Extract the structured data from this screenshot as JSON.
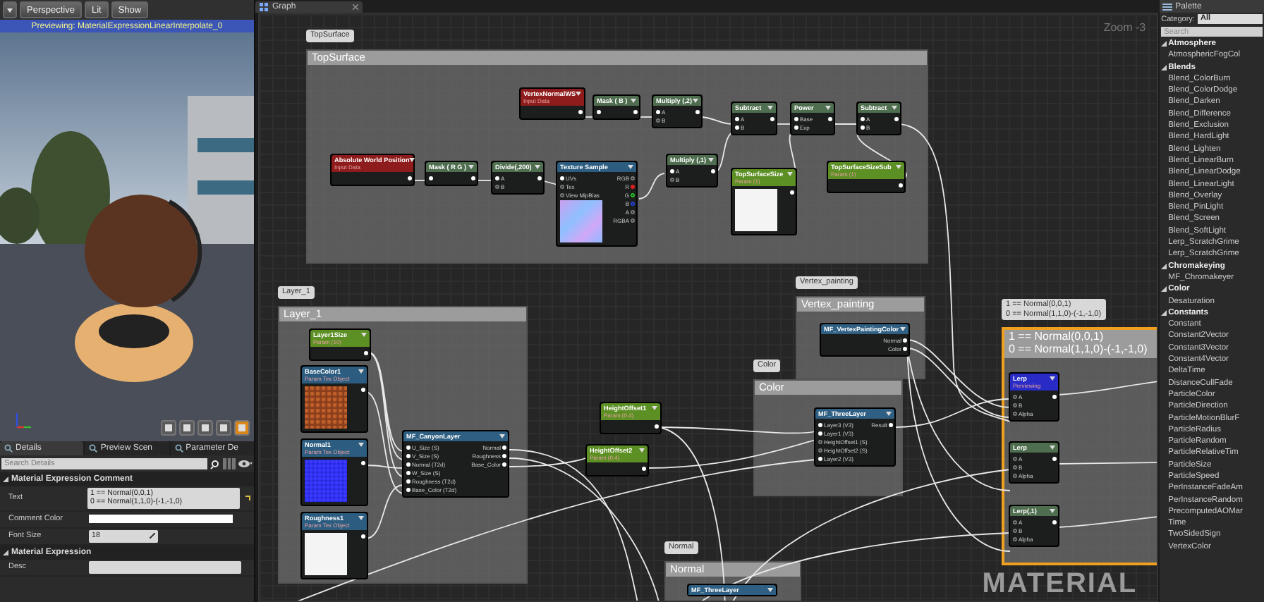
{
  "viewport": {
    "toolbar": [
      {
        "label": "Perspective"
      },
      {
        "label": "Lit"
      },
      {
        "label": "Show"
      }
    ],
    "status": "Previewing: MaterialExpressionLinearInterpolate_0",
    "view_buttons": [
      {
        "selected": false
      },
      {
        "selected": false
      },
      {
        "selected": false
      },
      {
        "selected": false
      },
      {
        "selected": true
      }
    ]
  },
  "details": {
    "tabs": [
      {
        "label": "Details",
        "selected": true
      },
      {
        "label": "Preview Scen",
        "selected": false
      },
      {
        "label": "Parameter De",
        "selected": false
      }
    ],
    "search": {
      "placeholder": "Search Details"
    },
    "sections": [
      {
        "title": "Material Expression Comment",
        "expanded": true,
        "rows": [
          {
            "kind": "multiline",
            "label": "Text",
            "value": "1 == Normal(0,0,1)\n0 == Normal(1,1,0)-(-1,-1,0)"
          },
          {
            "kind": "swatch",
            "label": "Comment Color"
          },
          {
            "kind": "number",
            "label": "Font Size",
            "value": "18"
          }
        ]
      },
      {
        "title": "Material Expression",
        "expanded": true,
        "rows": [
          {
            "kind": "field",
            "label": "Desc"
          }
        ]
      }
    ]
  },
  "graph": {
    "tab": "Graph",
    "zoom": "Zoom -3",
    "watermark": "MATERIAL",
    "comments": [
      {
        "bubble": "TopSurface",
        "title": "TopSurface",
        "selected": false
      },
      {
        "bubble": "Layer_1",
        "title": "Layer_1",
        "selected": false
      },
      {
        "bubble": "Vertex_painting",
        "title": "Vertex_painting",
        "selected": false
      },
      {
        "bubble": "Color",
        "title": "Color",
        "selected": false
      },
      {
        "bubble": "Normal",
        "title": "Normal",
        "selected": false
      },
      {
        "bubble": "1 == Normal(0,0,1)\n0 == Normal(1,1,0)-(-1,-1,0)",
        "title": "1 == Normal(0,0,1)\n0 == Normal(1,1,0)-(-1,-1,0)",
        "selected": true
      }
    ],
    "nodes": [
      {
        "kind": "input",
        "title": "VertexNormalWS",
        "subtitle": "Input Data",
        "selected": false,
        "outputs": [
          {
            "connected": true
          }
        ]
      },
      {
        "kind": "math",
        "title": "Mask ( B )",
        "selected": false,
        "inputs": [
          {
            "connected": true
          }
        ],
        "outputs": [
          {
            "connected": true
          }
        ]
      },
      {
        "kind": "math",
        "title": "Multiply (,2)",
        "selected": false,
        "inputs": [
          {
            "label": "A",
            "connected": true
          },
          {
            "label": "B",
            "connected": false
          }
        ],
        "outputs": [
          {
            "connected": true
          }
        ]
      },
      {
        "kind": "math",
        "title": "Subtract",
        "selected": false,
        "inputs": [
          {
            "label": "A",
            "connected": true
          },
          {
            "label": "B",
            "connected": true
          }
        ],
        "outputs": [
          {
            "connected": true
          }
        ]
      },
      {
        "kind": "math",
        "title": "Power",
        "selected": false,
        "inputs": [
          {
            "label": "Base",
            "connected": true
          },
          {
            "label": "Exp",
            "connected": true
          }
        ],
        "outputs": [
          {
            "connected": true
          }
        ]
      },
      {
        "kind": "math",
        "title": "Subtract",
        "selected": false,
        "inputs": [
          {
            "label": "A",
            "connected": true
          },
          {
            "label": "B",
            "connected": true
          }
        ],
        "outputs": [
          {
            "connected": true
          }
        ]
      },
      {
        "kind": "input",
        "title": "Absolute World Position",
        "subtitle": "Input Data",
        "selected": false,
        "outputs": [
          {
            "connected": true
          }
        ]
      },
      {
        "kind": "math",
        "title": "Mask ( R G )",
        "selected": false,
        "inputs": [
          {
            "connected": true
          }
        ],
        "outputs": [
          {
            "connected": true
          }
        ]
      },
      {
        "kind": "math",
        "title": "Divide(,200)",
        "selected": false,
        "inputs": [
          {
            "label": "A",
            "connected": true
          },
          {
            "label": "B",
            "connected": false
          }
        ],
        "outputs": [
          {
            "connected": true
          }
        ]
      },
      {
        "kind": "texture",
        "title": "Texture Sample",
        "selected": false,
        "thumbnail": {
          "kind": "noise"
        },
        "inputs": [
          {
            "label": "UVs",
            "connected": true
          },
          {
            "label": "Tex",
            "connected": false
          },
          {
            "label": "View MipBias",
            "connected": false
          }
        ],
        "outputs": [
          {
            "label": "RGB",
            "connected": false
          },
          {
            "label": "R",
            "connected": true,
            "color": "#e02020"
          },
          {
            "label": "G",
            "connected": false,
            "color": "#20c020"
          },
          {
            "label": "B",
            "connected": false,
            "color": "#2040d0"
          },
          {
            "label": "A",
            "connected": false
          },
          {
            "label": "RGBA",
            "connected": false
          }
        ]
      },
      {
        "kind": "math",
        "title": "Multiply (,1)",
        "selected": false,
        "inputs": [
          {
            "label": "A",
            "connected": true
          },
          {
            "label": "B",
            "connected": false
          }
        ],
        "outputs": [
          {
            "connected": true
          }
        ]
      },
      {
        "kind": "param",
        "title": "TopSurfaceSize",
        "subtitle": "Param (1)",
        "selected": false,
        "thumbnail": {
          "kind": "blank"
        },
        "outputs": [
          {
            "connected": true
          }
        ]
      },
      {
        "kind": "param",
        "title": "TopSurfaceSizeSub",
        "subtitle": "Param (1)",
        "selected": false,
        "outputs": [
          {
            "connected": true
          }
        ]
      },
      {
        "kind": "param",
        "title": "Layer1Size",
        "subtitle": "Param (10)",
        "selected": false,
        "outputs": [
          {
            "connected": true
          }
        ]
      },
      {
        "kind": "texture",
        "title": "BaseColor1",
        "subtitle": "Param Tex Object",
        "selected": false,
        "thumbnail": {
          "kind": "rock"
        },
        "outputs": [
          {
            "connected": true
          }
        ]
      },
      {
        "kind": "texture",
        "title": "Normal1",
        "subtitle": "Param Tex Object",
        "selected": false,
        "thumbnail": {
          "kind": "normal"
        },
        "outputs": [
          {
            "connected": true
          }
        ]
      },
      {
        "kind": "texture",
        "title": "Roughness1",
        "subtitle": "Param Tex Object",
        "selected": false,
        "thumbnail": {
          "kind": "blank"
        },
        "outputs": [
          {
            "connected": true
          }
        ]
      },
      {
        "kind": "function",
        "title": "MF_CanyonLayer",
        "selected": false,
        "inputs": [
          {
            "label": "U_Size (S)",
            "connected": true
          },
          {
            "label": "V_Size (S)",
            "connected": true
          },
          {
            "label": "Normal (T2d)",
            "connected": true
          },
          {
            "label": "W_Size (S)",
            "connected": true
          },
          {
            "label": "Roughness (T2d)",
            "connected": true
          },
          {
            "label": "Base_Color (T2d)",
            "connected": true
          }
        ],
        "outputs": [
          {
            "label": "Normal",
            "connected": true
          },
          {
            "label": "Roughness",
            "connected": true
          },
          {
            "label": "Base_Color",
            "connected": true
          }
        ]
      },
      {
        "kind": "param",
        "title": "HeightOffset1",
        "subtitle": "Param (0.4)",
        "selected": false,
        "outputs": [
          {
            "connected": true
          }
        ]
      },
      {
        "kind": "param",
        "title": "HeightOffset2",
        "subtitle": "Param (0.4)",
        "selected": false,
        "outputs": [
          {
            "connected": true
          }
        ]
      },
      {
        "kind": "function",
        "title": "MF_VertexPaintingColor",
        "selected": false,
        "outputs": [
          {
            "label": "Normal",
            "connected": true
          },
          {
            "label": "Color",
            "connected": true
          }
        ]
      },
      {
        "kind": "function",
        "title": "MF_ThreeLayer",
        "selected": false,
        "inputs": [
          {
            "label": "Layer3 (V3)",
            "connected": true
          },
          {
            "label": "Layer1 (V3)",
            "connected": true
          },
          {
            "label": "HeightOffset1 (S)",
            "connected": false
          },
          {
            "label": "HeightOffset2 (S)",
            "connected": false
          },
          {
            "label": "Layer2 (V3)",
            "connected": true
          }
        ],
        "outputs": [
          {
            "label": "Result",
            "connected": true
          }
        ]
      },
      {
        "kind": "math",
        "title": "Lerp",
        "subtitle": "Previewing",
        "selected": true,
        "inputs": [
          {
            "label": "A",
            "connected": false
          },
          {
            "label": "B",
            "connected": false
          },
          {
            "label": "Alpha",
            "connected": false
          }
        ],
        "outputs": [
          {
            "connected": true
          }
        ]
      },
      {
        "kind": "math",
        "title": "Lerp",
        "selected": false,
        "inputs": [
          {
            "label": "A",
            "connected": false
          },
          {
            "label": "B",
            "connected": false
          },
          {
            "label": "Alpha",
            "connected": false
          }
        ],
        "outputs": [
          {
            "connected": true
          }
        ]
      },
      {
        "kind": "math",
        "title": "Lerp(,1)",
        "selected": false,
        "inputs": [
          {
            "label": "A",
            "connected": false
          },
          {
            "label": "B",
            "connected": false
          },
          {
            "label": "Alpha",
            "connected": false
          }
        ],
        "outputs": [
          {
            "connected": true
          }
        ]
      },
      {
        "kind": "function",
        "title": "MF_ThreeLayer",
        "selected": false
      }
    ]
  },
  "palette": {
    "title": "Palette",
    "category_label": "Category:",
    "category": "All",
    "search": {
      "placeholder": "Search"
    },
    "groups": [
      {
        "label": "Atmosphere",
        "expanded": true,
        "children": [
          "AtmosphericFogCol"
        ]
      },
      {
        "label": "Blends",
        "expanded": true,
        "children": [
          "Blend_ColorBurn",
          "Blend_ColorDodge",
          "Blend_Darken",
          "Blend_Difference",
          "Blend_Exclusion",
          "Blend_HardLight",
          "Blend_Lighten",
          "Blend_LinearBurn",
          "Blend_LinearDodge",
          "Blend_LinearLight",
          "Blend_Overlay",
          "Blend_PinLight",
          "Blend_Screen",
          "Blend_SoftLight",
          "Lerp_ScratchGrime",
          "Lerp_ScratchGrime"
        ]
      },
      {
        "label": "Chromakeying",
        "expanded": true,
        "children": [
          "MF_Chromakeyer"
        ]
      },
      {
        "label": "Color",
        "expanded": true,
        "children": [
          "Desaturation"
        ]
      },
      {
        "label": "Constants",
        "expanded": true,
        "children": [
          "Constant",
          "Constant2Vector",
          "Constant3Vector",
          "Constant4Vector",
          "DeltaTime",
          "DistanceCullFade",
          "ParticleColor",
          "ParticleDirection",
          "ParticleMotionBlurF",
          "ParticleRadius",
          "ParticleRandom",
          "ParticleRelativeTim",
          "ParticleSize",
          "ParticleSpeed",
          "PerInstanceFadeAm",
          "PerInstanceRandom",
          "PrecomputedAOMar",
          "Time",
          "TwoSidedSign",
          "VertexColor"
        ]
      }
    ]
  }
}
